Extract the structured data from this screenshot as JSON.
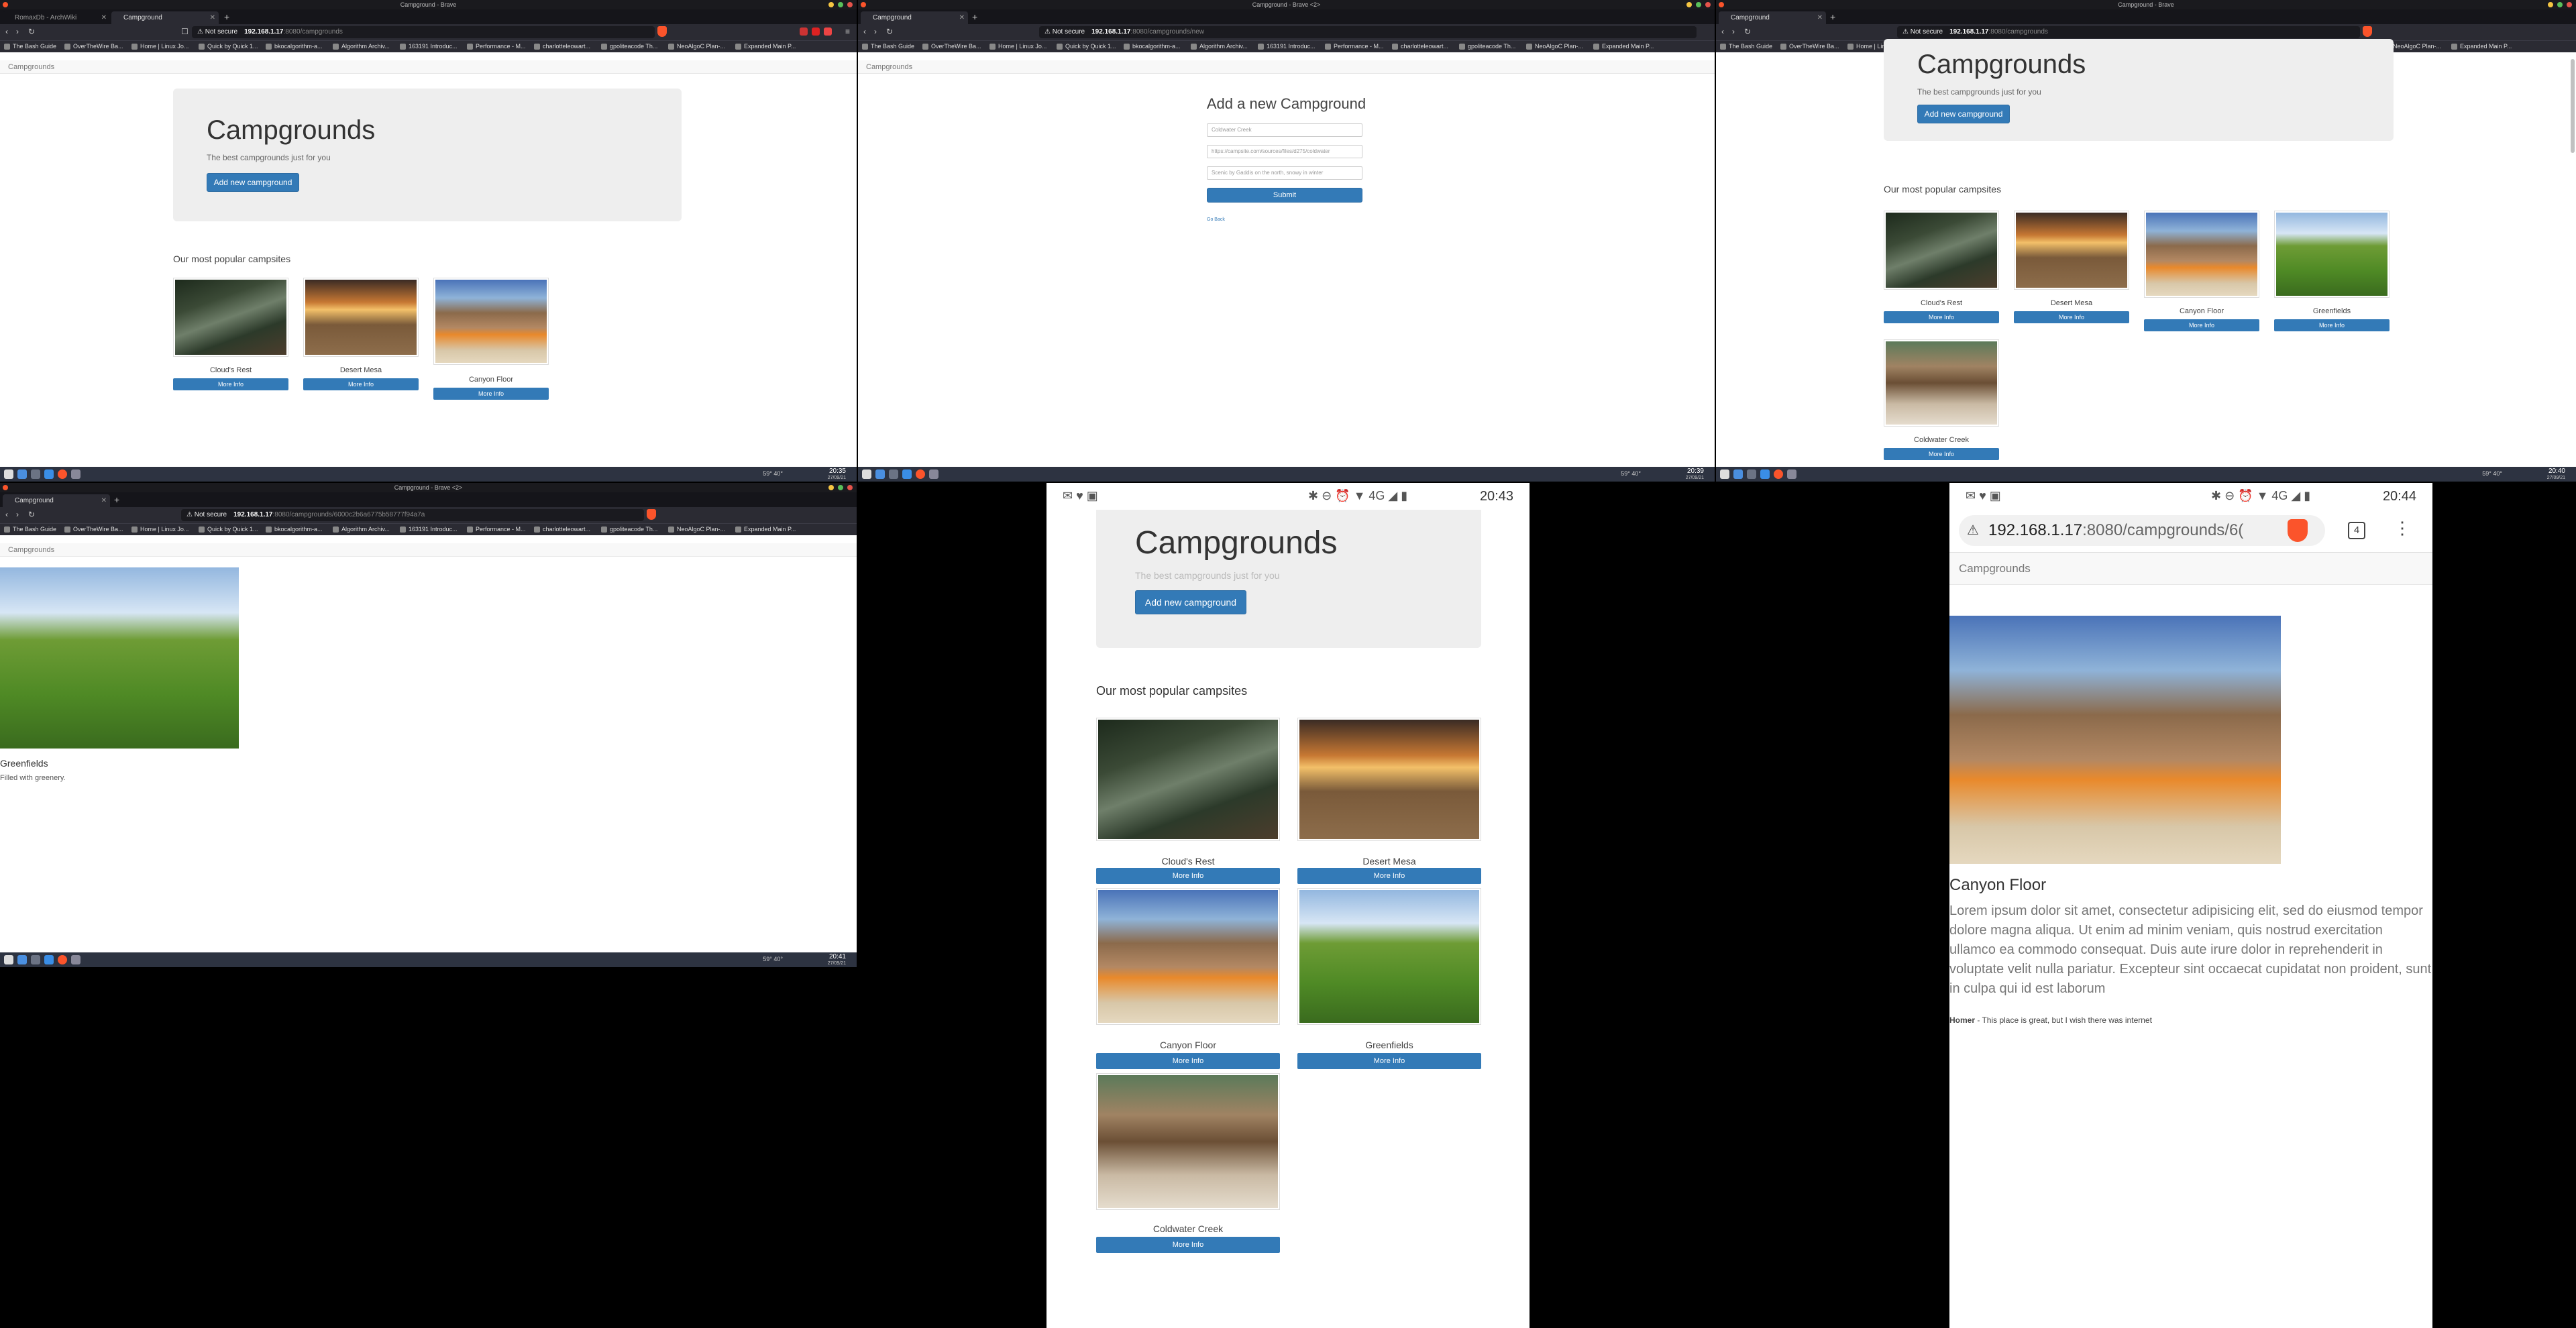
{
  "window1": {
    "title": "Campground - Brave",
    "tabs": [
      "RomaxDb - ArchWiki",
      "Campground"
    ],
    "url_warning": "Not secure",
    "url_host": "192.168.1.17",
    "url_path": ":8080/campgrounds",
    "bookmarks": [
      "The Bash Guide",
      "OverTheWire Ba...",
      "Home | Linux Jo...",
      "Quick by Quick 1...",
      "bkocalgorithm-a...",
      "Algorithm Archiv...",
      "163191 Introduc...",
      "Performance - M...",
      "charlotteleowart...",
      "gpoliteacode Th...",
      "NeoAlgoC Plan-...",
      "Expanded Main P..."
    ],
    "clock": "20:35",
    "date": "27/09/21",
    "tray": "59° 40°"
  },
  "window2": {
    "title": "Campground - Brave <2>",
    "tabs": [
      "Campground"
    ],
    "url_warning": "Not secure",
    "url_host": "192.168.1.17",
    "url_path": ":8080/campgrounds/new",
    "form_title": "Add a new Campground",
    "name_value": "Coldwater Creek",
    "image_value": "https://campsite.com/sources/files/d275/coldwater",
    "desc_value": "Scenic by Gaddis on the north, snowy in winter",
    "submit": "Submit",
    "back": "Go Back",
    "clock": "20:39",
    "date": "27/09/21"
  },
  "window3": {
    "title": "Campground - Brave",
    "tabs": [
      "Campground"
    ],
    "url_warning": "Not secure",
    "url_host": "192.168.1.17",
    "url_path": ":8080/campgrounds",
    "clock": "20:40",
    "date": "27/09/21"
  },
  "window4": {
    "title": "Campground - Brave <2>",
    "tabs": [
      "Campground"
    ],
    "url_warning": "Not secure",
    "url_host": "192.168.1.17",
    "url_path": ":8080/campgrounds/6000c2b6a6775b58777f94a7a",
    "show_name": "Greenfields",
    "show_desc": "Filled with greenery.",
    "clock": "20:41",
    "date": "27/09/21"
  },
  "site": {
    "brand": "Campgrounds",
    "heading": "Campgrounds",
    "tagline": "The best campgrounds just for you",
    "add_button": "Add new campground",
    "section": "Our most popular campsites",
    "more": "More Info",
    "sites": [
      "Cloud's Rest",
      "Desert Mesa",
      "Canyon Floor",
      "Greenfields",
      "Coldwater Creek"
    ]
  },
  "phone1": {
    "time": "20:43",
    "signal": "4G"
  },
  "phone2": {
    "time": "20:44",
    "signal": "4G",
    "url_host": "192.168.1.17",
    "url_path": ":8080/campgrounds/6(",
    "tabs_count": "4",
    "show_name": "Canyon Floor",
    "lorem": "Lorem ipsum dolor sit amet, consectetur adipisicing elit, sed do eiusmod tempor dolore magna aliqua. Ut enim ad minim veniam, quis nostrud exercitation ullamco ea commodo consequat. Duis aute irure dolor in reprehenderit in voluptate velit nulla pariatur. Excepteur sint occaecat cupidatat non proident, sunt in culpa qui id est laborum",
    "comment_author": "Homer",
    "comment_text": " - This place is great, but I wish there was internet"
  }
}
